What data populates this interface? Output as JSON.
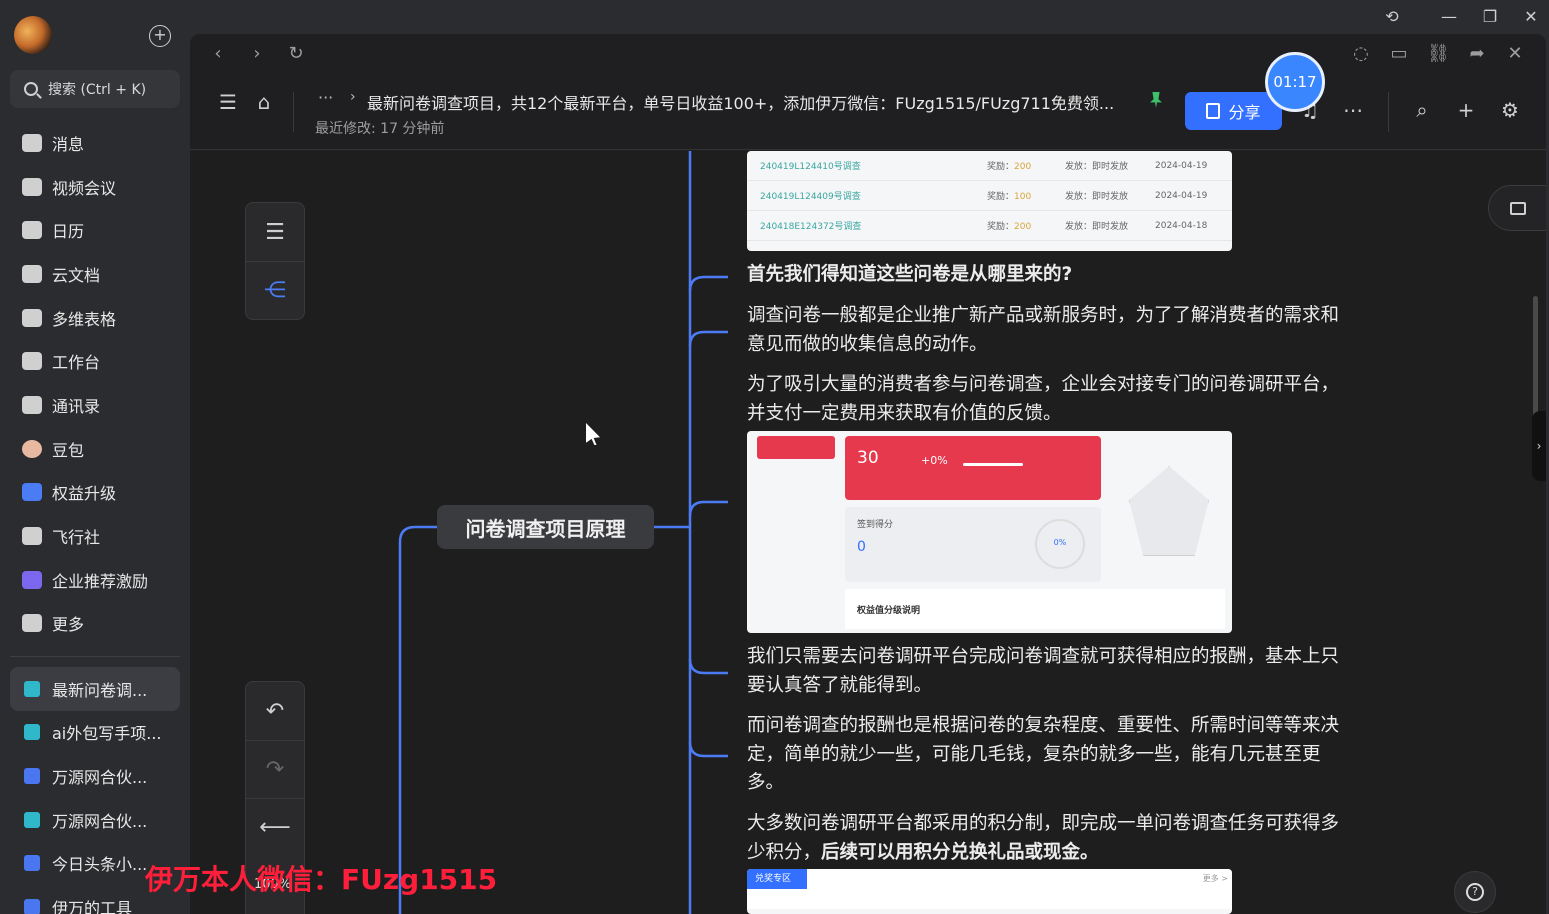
{
  "window": {
    "controls": {
      "history": "⟲",
      "minimize": "—",
      "restore": "❐",
      "close": "✕"
    }
  },
  "sidebar": {
    "search_label": "搜索 (Ctrl + K)",
    "nav": [
      {
        "label": "消息",
        "icon": "chat-icon"
      },
      {
        "label": "视频会议",
        "icon": "video-icon"
      },
      {
        "label": "日历",
        "icon": "calendar-icon"
      },
      {
        "label": "云文档",
        "icon": "doc-icon"
      },
      {
        "label": "多维表格",
        "icon": "table-icon"
      },
      {
        "label": "工作台",
        "icon": "grid-icon"
      },
      {
        "label": "通讯录",
        "icon": "contacts-icon"
      },
      {
        "label": "豆包",
        "icon": "doubao-icon"
      },
      {
        "label": "权益升级",
        "icon": "diamond-icon"
      },
      {
        "label": "飞行社",
        "icon": "book-icon"
      },
      {
        "label": "企业推荐激励",
        "icon": "user-icon"
      },
      {
        "label": "更多",
        "icon": "more-apps-icon"
      }
    ],
    "docs": [
      {
        "label": "最新问卷调...",
        "type": "mind"
      },
      {
        "label": "ai外包写手项...",
        "type": "mind"
      },
      {
        "label": "万源网合伙...",
        "type": "doc"
      },
      {
        "label": "万源网合伙...",
        "type": "mind"
      },
      {
        "label": "今日头条小...",
        "type": "doc"
      },
      {
        "label": "伊万的工具",
        "type": "doc"
      }
    ]
  },
  "header": {
    "dots": "···",
    "title": "最新问卷调查项目，共12个最新平台，单号日收益100+，添加伊万微信：FUzg1515/FUzg711免费领...",
    "modified": "最近修改: 17 分钟前",
    "share_label": "分享",
    "timer": "01:17"
  },
  "canvas": {
    "zoom": "100%",
    "root": "问卷调查项目原理",
    "table_rows": [
      {
        "name": "240419L124410号调查",
        "reward_label": "奖励：",
        "reward": "200",
        "issue": "发放：即时发放",
        "date": "2024-04-19"
      },
      {
        "name": "240419L124409号调查",
        "reward_label": "奖励：",
        "reward": "100",
        "issue": "发放：即时发放",
        "date": "2024-04-19"
      },
      {
        "name": "240418E124372号调查",
        "reward_label": "奖励：",
        "reward": "200",
        "issue": "发放：即时发放",
        "date": "2024-04-18"
      }
    ],
    "heading": "首先我们得知道这些问卷是从哪里来的?",
    "p1": "调查问卷一般都是企业推广新产品或新服务时，为了了解消费者的需求和意见而做的收集信息的动作。",
    "p2": "为了吸引大量的消费者参与问卷调查，企业会对接专门的问卷调研平台，并支付一定费用来获取有价值的反馈。",
    "dashboard": {
      "num": "30",
      "pct": "+0%",
      "points_label": "签到得分",
      "points_value": "0",
      "ring": "0%",
      "footer": "权益值分级说明"
    },
    "p3": "我们只需要去问卷调研平台完成问卷调查就可获得相应的报酬，基本上只要认真答了就能得到。",
    "p4": "而问卷调查的报酬也是根据问卷的复杂程度、重要性、所需时间等等来决定，简单的就少一些，可能几毛钱，复杂的就多一些，能有几元甚至更多。",
    "p5_a": "大多数问卷调研平台都采用的积分制，即完成一单问卷调查任务可获得多少积分，",
    "p5_b": "后续可以用积分兑换礼品或现金。",
    "strip_tag": "兑奖专区",
    "strip_more": "更多 >"
  },
  "watermark": "伊万本人微信：FUzg1515",
  "colors": {
    "accent": "#3370ff",
    "watermark": "#ff1f3a",
    "branch": "#4c7cf5"
  }
}
